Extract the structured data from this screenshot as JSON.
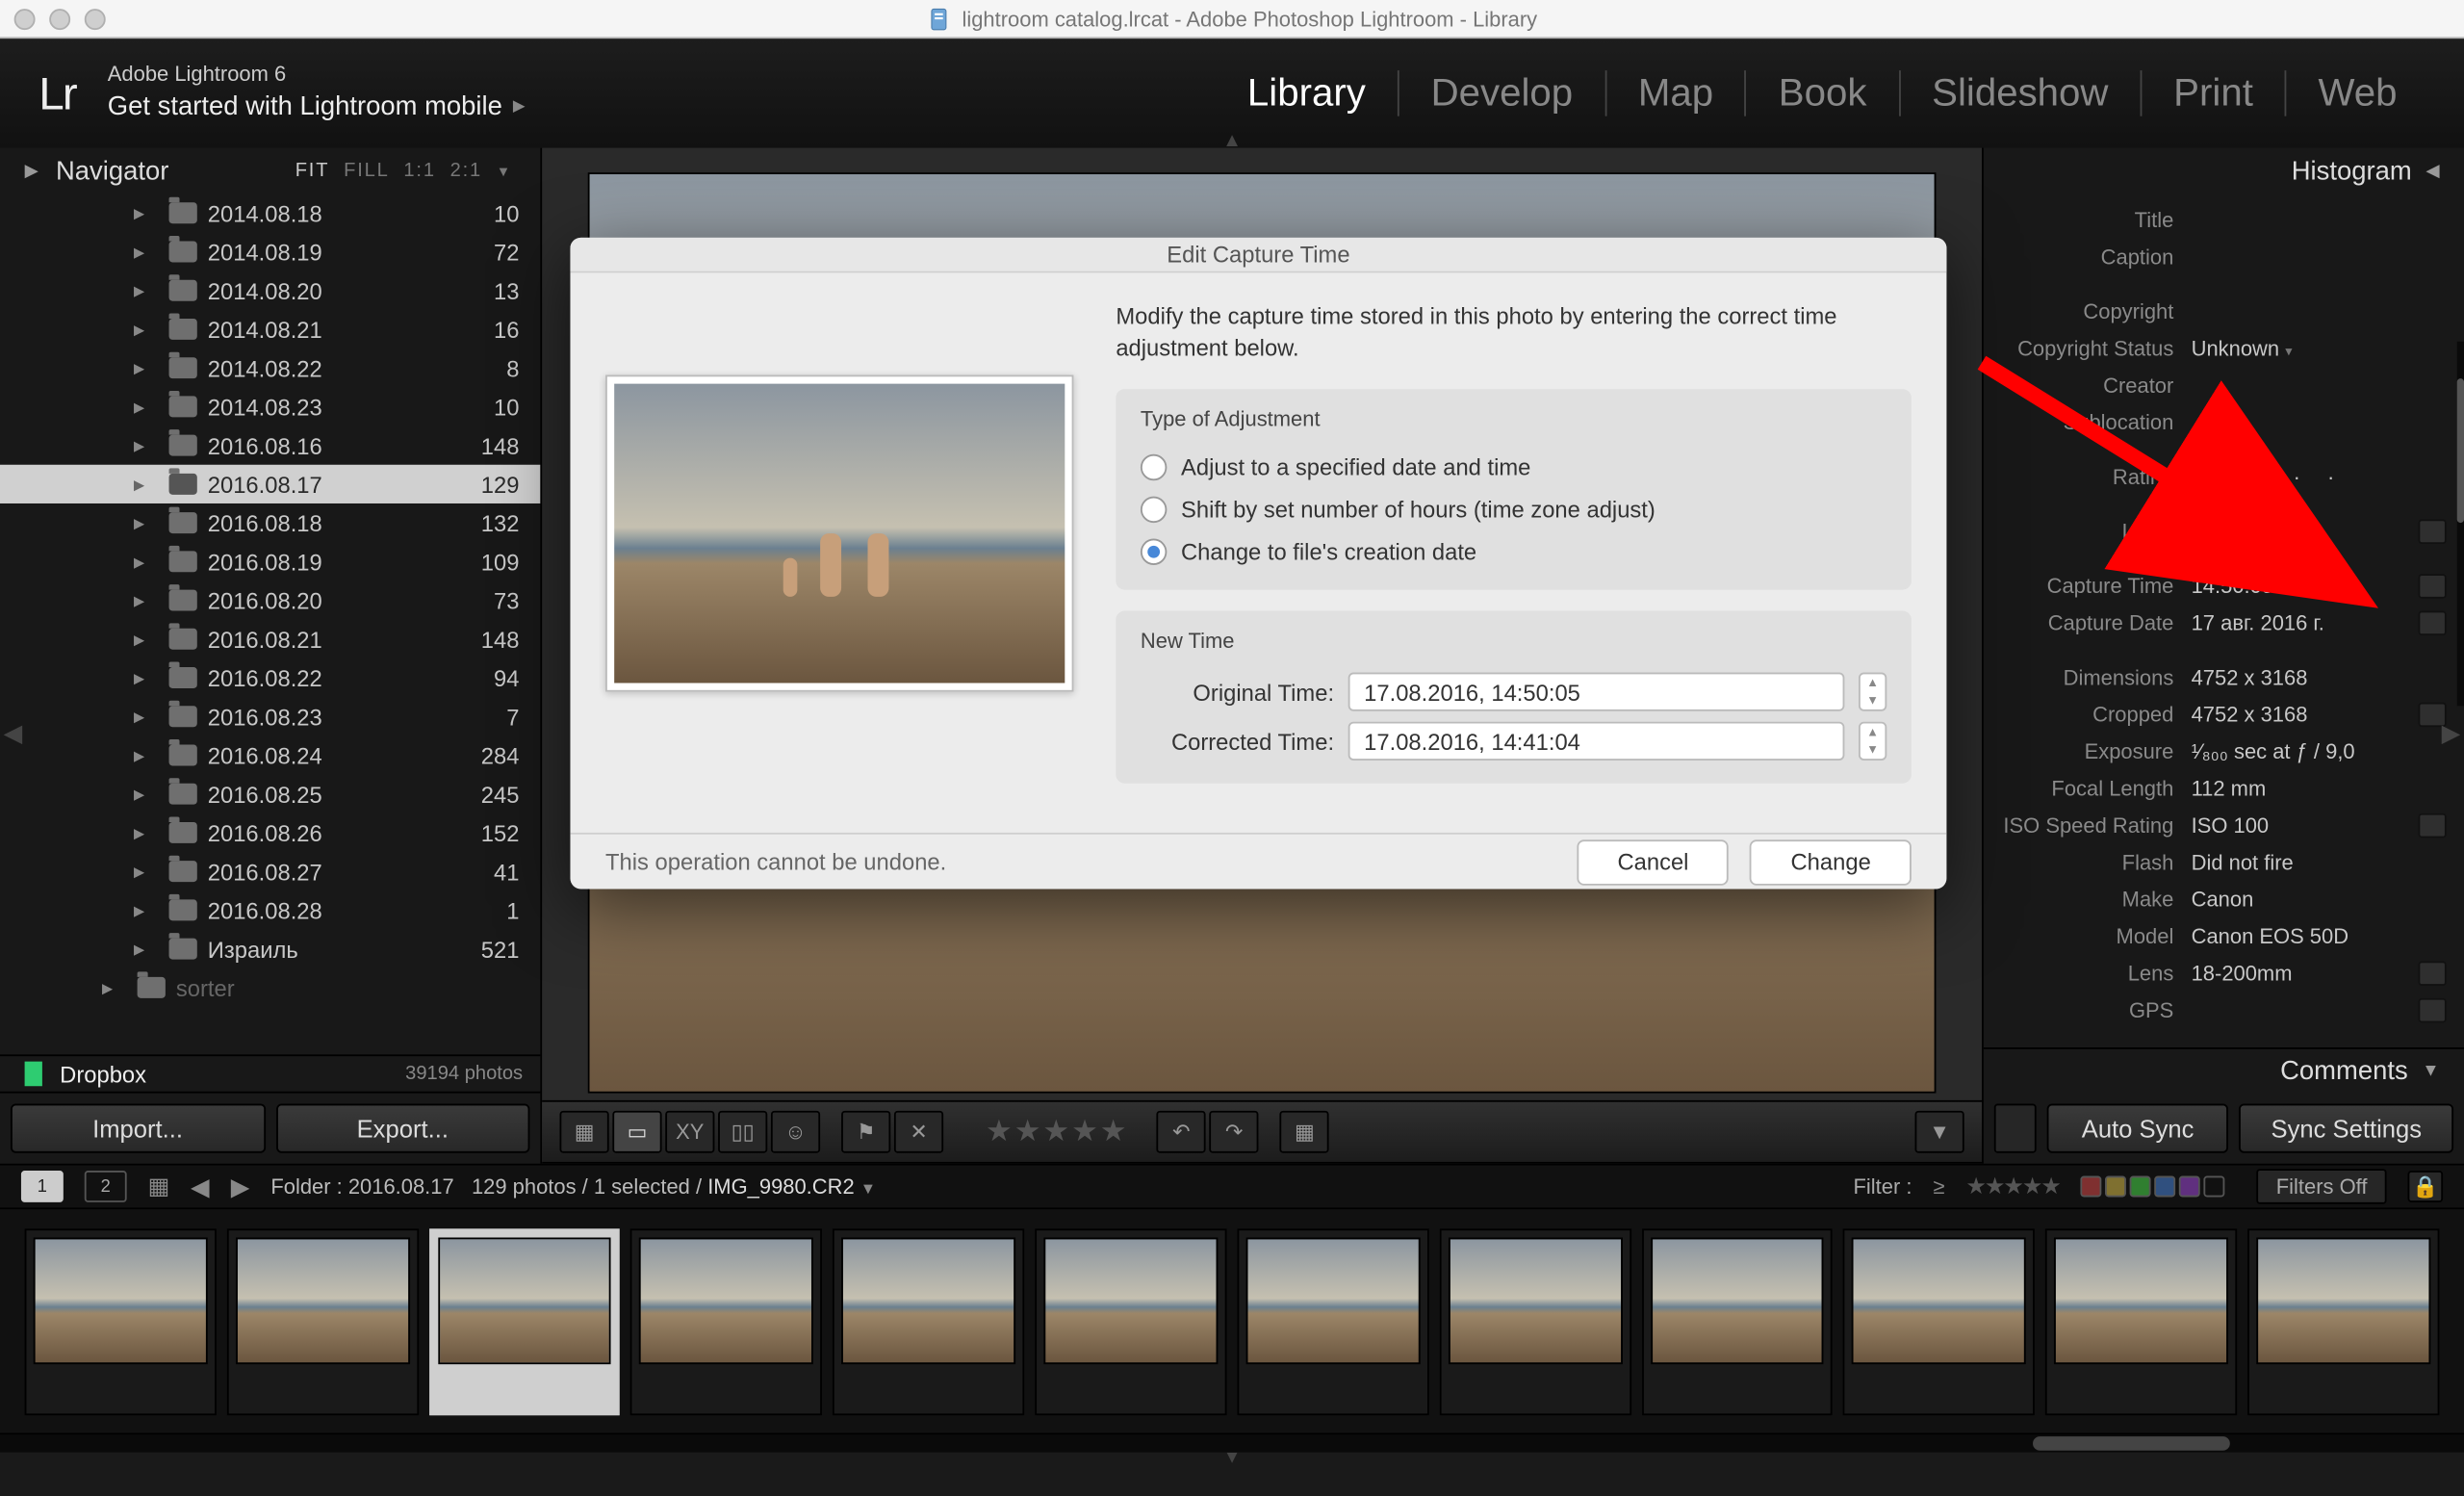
{
  "window_title": "lightroom catalog.lrcat - Adobe Photoshop Lightroom - Library",
  "app_name": "Adobe Lightroom 6",
  "header_subtitle": "Get started with Lightroom mobile",
  "modules": [
    "Library",
    "Develop",
    "Map",
    "Book",
    "Slideshow",
    "Print",
    "Web"
  ],
  "active_module": "Library",
  "navigator": {
    "title": "Navigator",
    "zoom_options": [
      "FIT",
      "FILL",
      "1:1",
      "2:1"
    ],
    "zoom_active": "FIT"
  },
  "folders": [
    {
      "name": "2014.08.18",
      "count": "10"
    },
    {
      "name": "2014.08.19",
      "count": "72"
    },
    {
      "name": "2014.08.20",
      "count": "13"
    },
    {
      "name": "2014.08.21",
      "count": "16"
    },
    {
      "name": "2014.08.22",
      "count": "8"
    },
    {
      "name": "2014.08.23",
      "count": "10"
    },
    {
      "name": "2016.08.16",
      "count": "148"
    },
    {
      "name": "2016.08.17",
      "count": "129",
      "selected": true
    },
    {
      "name": "2016.08.18",
      "count": "132"
    },
    {
      "name": "2016.08.19",
      "count": "109"
    },
    {
      "name": "2016.08.20",
      "count": "73"
    },
    {
      "name": "2016.08.21",
      "count": "148"
    },
    {
      "name": "2016.08.22",
      "count": "94"
    },
    {
      "name": "2016.08.23",
      "count": "7"
    },
    {
      "name": "2016.08.24",
      "count": "284"
    },
    {
      "name": "2016.08.25",
      "count": "245"
    },
    {
      "name": "2016.08.26",
      "count": "152"
    },
    {
      "name": "2016.08.27",
      "count": "41"
    },
    {
      "name": "2016.08.28",
      "count": "1"
    },
    {
      "name": "Израиль",
      "count": "521"
    },
    {
      "name": "sorter",
      "count": "",
      "dim": true,
      "indent": 1
    }
  ],
  "dropbox": {
    "label": "Dropbox",
    "count": "39194 photos"
  },
  "left_buttons": {
    "import": "Import...",
    "export": "Export..."
  },
  "histogram_title": "Histogram",
  "metadata": {
    "Title": "",
    "Caption": "",
    "Copyright": "",
    "Copyright Status": "Unknown",
    "Creator": "",
    "Sublocation": "",
    "Rating": "",
    "Label": "",
    "Capture Time": "14:50:05",
    "Capture Date": "17 авг. 2016 г.",
    "Dimensions": "4752 x 3168",
    "Cropped": "4752 x 3168",
    "Exposure": "¹⁄₈₀₀ sec at ƒ / 9,0",
    "Focal Length": "112 mm",
    "ISO Speed Rating": "ISO 100",
    "Flash": "Did not fire",
    "Make": "Canon",
    "Model": "Canon EOS 50D",
    "Lens": "18-200mm",
    "GPS": ""
  },
  "comments_title": "Comments",
  "right_buttons": {
    "autosync": "Auto Sync",
    "syncsettings": "Sync Settings"
  },
  "infobar": {
    "folder": "Folder : 2016.08.17",
    "count": "129 photos / 1 selected /",
    "file": "IMG_9980.CR2",
    "filter_label": "Filter :",
    "filters_off": "Filters Off"
  },
  "modal": {
    "title": "Edit Capture Time",
    "desc": "Modify the capture time stored in this photo by entering the correct time adjustment below.",
    "type_heading": "Type of Adjustment",
    "options": [
      "Adjust to a specified date and time",
      "Shift by set number of hours (time zone adjust)",
      "Change to file's creation date"
    ],
    "selected_option": 2,
    "newtime_heading": "New Time",
    "original_label": "Original Time:",
    "original_value": "17.08.2016, 14:50:05",
    "corrected_label": "Corrected Time:",
    "corrected_value": "17.08.2016, 14:41:04",
    "warning": "This operation cannot be undone.",
    "cancel": "Cancel",
    "change": "Change"
  }
}
